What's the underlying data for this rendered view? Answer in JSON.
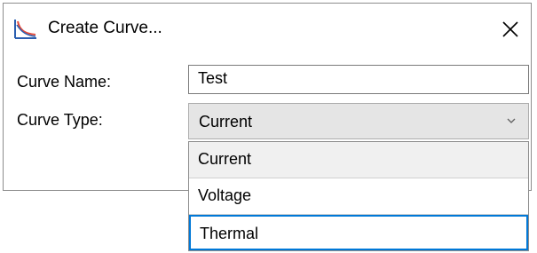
{
  "dialog": {
    "title": "Create Curve...",
    "app_icon": "curve-chart-icon",
    "close_icon": "close-icon"
  },
  "form": {
    "curve_name_label": "Curve Name:",
    "curve_name_value": "Test",
    "curve_type_label": "Curve Type:",
    "curve_type_value": "Current",
    "chevron_icon": "chevron-down-icon"
  },
  "dropdown": {
    "options": [
      {
        "label": "Current",
        "state": "selected"
      },
      {
        "label": "Voltage",
        "state": "normal"
      },
      {
        "label": "Thermal",
        "state": "focused"
      }
    ]
  },
  "colors": {
    "focus_border": "#0078d7",
    "combo_background": "#e5e5e5",
    "selected_option_background": "#f0f0f0"
  }
}
